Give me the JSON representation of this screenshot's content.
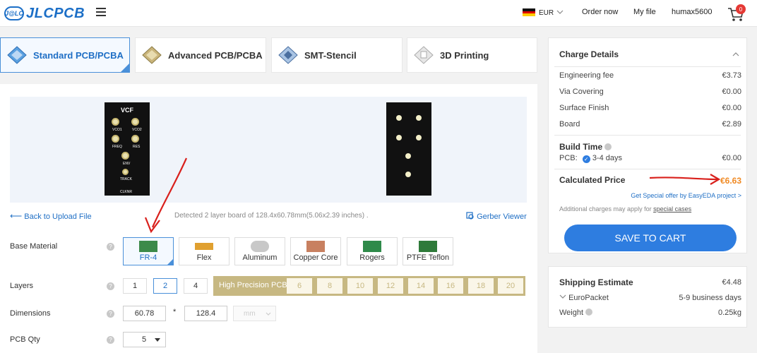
{
  "header": {
    "logo_badge": "J@LC",
    "logo_text": "JLCPCB",
    "currency": "EUR",
    "nav_order_now": "Order now",
    "nav_my_file": "My file",
    "username": "humax5600",
    "cart_count": "0"
  },
  "tabs": [
    {
      "label": "Standard PCB/PCBA",
      "active": true
    },
    {
      "label": "Advanced PCB/PCBA",
      "active": false
    },
    {
      "label": "SMT-Stencil",
      "active": false
    },
    {
      "label": "3D Printing",
      "active": false
    }
  ],
  "preview": {
    "pcb_title": "VCF",
    "pcb_labels": [
      "VCO1",
      "VCO2",
      "FREQ",
      "RES",
      "ENV",
      "TRACK",
      "CLKNR"
    ],
    "back_link": "Back to Upload File",
    "detected_text": "Detected 2 layer board of 128.4x60.78mm(5.06x2.39 inches) .",
    "gerber_viewer": "Gerber Viewer"
  },
  "options": {
    "base_material_label": "Base Material",
    "materials": [
      {
        "label": "FR-4",
        "active": true,
        "color": "#3c8a4a"
      },
      {
        "label": "Flex",
        "active": false,
        "color": "#e0a030"
      },
      {
        "label": "Aluminum",
        "active": false,
        "color": "#c8c8c8"
      },
      {
        "label": "Copper Core",
        "active": false,
        "color": "#c88060"
      },
      {
        "label": "Rogers",
        "active": false,
        "color": "#2f8a4a"
      },
      {
        "label": "PTFE Teflon",
        "active": false,
        "color": "#2f7a3a"
      }
    ],
    "layers_label": "Layers",
    "layers": [
      "1",
      "2",
      "4"
    ],
    "layers_selected": "2",
    "high_precision_label": "High Precision PCB",
    "high_precision_layers": [
      "6",
      "8",
      "10",
      "12",
      "14",
      "16",
      "18",
      "20"
    ],
    "dimensions_label": "Dimensions",
    "dim_width": "60.78",
    "dim_separator": "*",
    "dim_height": "128.4",
    "dim_unit": "mm",
    "qty_label": "PCB Qty",
    "qty_value": "5"
  },
  "charge": {
    "title": "Charge Details",
    "rows": [
      {
        "label": "Engineering fee",
        "value": "€3.73"
      },
      {
        "label": "Via Covering",
        "value": "€0.00"
      },
      {
        "label": "Surface Finish",
        "value": "€0.00"
      },
      {
        "label": "Board",
        "value": "€2.89"
      }
    ],
    "build_time_title": "Build Time",
    "build_pcb_label": "PCB:",
    "build_days": "3-4 days",
    "build_price": "€0.00",
    "calculated_label": "Calculated Price",
    "calculated_value": "€6.63",
    "special_offer": "Get Special offer by EasyEDA project >",
    "additional_text": "Additional charges may apply for",
    "additional_link": "special cases",
    "save_button": "SAVE TO CART"
  },
  "shipping": {
    "title": "Shipping Estimate",
    "price": "€4.48",
    "method": "EuroPacket",
    "method_time": "5-9 business days",
    "weight_label": "Weight",
    "weight_value": "0.25kg"
  },
  "colors": {
    "accent": "#2e7de0",
    "price_highlight": "#f08a24",
    "high_precision": "#c7b882",
    "annotation_arrow": "#d9201c"
  }
}
